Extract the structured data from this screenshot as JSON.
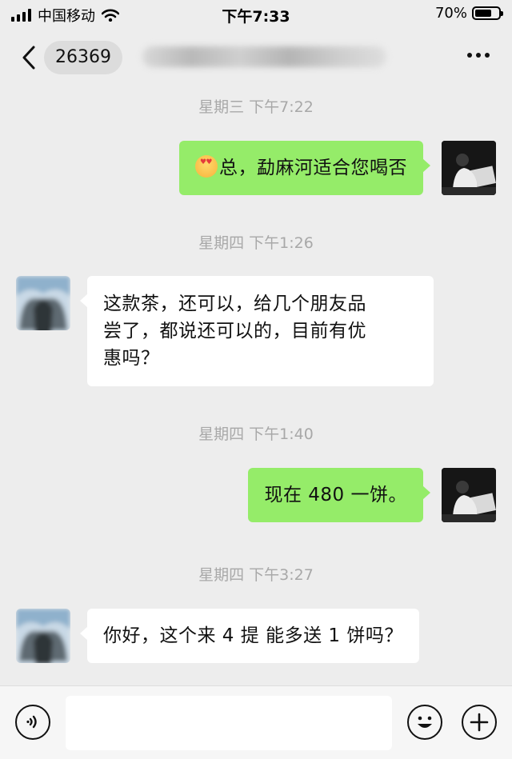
{
  "status_bar": {
    "carrier": "中国移动",
    "time": "下午7:33",
    "battery": "70%",
    "battery_level": 0.7
  },
  "header": {
    "badge_number": "26369"
  },
  "messages": [
    {
      "timestamp": "星期三 下午7:22",
      "sender": "self",
      "text": "总，勐麻河适合您喝否",
      "has_emoji": true
    },
    {
      "timestamp": "星期四 下午1:26",
      "sender": "other",
      "lines": [
        "这款茶，还可以，给几个朋友品",
        "尝了，都说还可以的，目前有优",
        "惠吗？"
      ]
    },
    {
      "timestamp": "星期四 下午1:40",
      "sender": "self",
      "text": "现在 480 一饼。"
    },
    {
      "timestamp": "星期四 下午3:27",
      "sender": "other",
      "text": "你好，这个来 4 提 能多送 1 饼吗？"
    }
  ],
  "colors": {
    "background": "#ededed",
    "self_bubble": "#95ec69",
    "other_bubble": "#ffffff",
    "timestamp": "#a8a8a8"
  },
  "icons": [
    "back-icon",
    "more-icon",
    "voice-icon",
    "emoji-icon",
    "plus-icon"
  ]
}
